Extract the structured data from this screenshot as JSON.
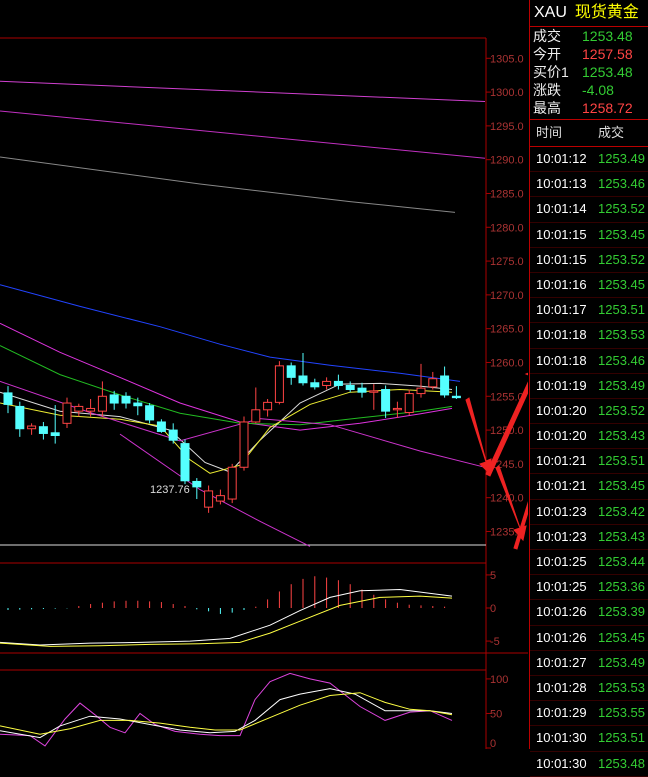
{
  "sidebar": {
    "symbol": "XAU",
    "name": "现货黄金",
    "quotes": [
      {
        "label": "成交",
        "value": "1253.48",
        "color": "#3c3"
      },
      {
        "label": "今开",
        "value": "1257.58",
        "color": "#f44"
      },
      {
        "label": "买价1",
        "value": "1253.48",
        "color": "#3c3"
      },
      {
        "label": "涨跌",
        "value": "-4.08",
        "color": "#3c3"
      },
      {
        "label": "最高",
        "value": "1258.72",
        "color": "#f44"
      }
    ],
    "tick_header": {
      "time": "时间",
      "price": "成交"
    },
    "ticks": [
      {
        "time": "10:01:12",
        "price": "1253.49"
      },
      {
        "time": "10:01:13",
        "price": "1253.46"
      },
      {
        "time": "10:01:14",
        "price": "1253.52"
      },
      {
        "time": "10:01:15",
        "price": "1253.45"
      },
      {
        "time": "10:01:15",
        "price": "1253.52"
      },
      {
        "time": "10:01:16",
        "price": "1253.45"
      },
      {
        "time": "10:01:17",
        "price": "1253.51"
      },
      {
        "time": "10:01:18",
        "price": "1253.53"
      },
      {
        "time": "10:01:18",
        "price": "1253.46"
      },
      {
        "time": "10:01:19",
        "price": "1253.49"
      },
      {
        "time": "10:01:20",
        "price": "1253.52"
      },
      {
        "time": "10:01:20",
        "price": "1253.43"
      },
      {
        "time": "10:01:21",
        "price": "1253.51"
      },
      {
        "time": "10:01:21",
        "price": "1253.45"
      },
      {
        "time": "10:01:23",
        "price": "1253.42"
      },
      {
        "time": "10:01:23",
        "price": "1253.43"
      },
      {
        "time": "10:01:25",
        "price": "1253.44"
      },
      {
        "time": "10:01:25",
        "price": "1253.36"
      },
      {
        "time": "10:01:26",
        "price": "1253.39"
      },
      {
        "time": "10:01:26",
        "price": "1253.45"
      },
      {
        "time": "10:01:27",
        "price": "1253.49"
      },
      {
        "time": "10:01:28",
        "price": "1253.53"
      },
      {
        "time": "10:01:29",
        "price": "1253.55"
      },
      {
        "time": "10:01:30",
        "price": "1253.51"
      },
      {
        "time": "10:01:30",
        "price": "1253.48"
      }
    ]
  },
  "chart_data": {
    "type": "candlestick",
    "price_ticks": [
      "1305.0",
      "1300.0",
      "1295.0",
      "1290.0",
      "1285.0",
      "1280.0",
      "1275.0",
      "1270.0",
      "1265.0",
      "1260.0",
      "1255.0",
      "1250.0",
      "1245.0",
      "1240.0",
      "1235.0"
    ],
    "ylim": [
      1233,
      1308
    ],
    "low_annotation": "1237.76",
    "candles": [
      {
        "o": 1255.5,
        "h": 1256.5,
        "l": 1252.5,
        "c": 1253.8
      },
      {
        "o": 1253.5,
        "h": 1254.2,
        "l": 1249.0,
        "c": 1250.2
      },
      {
        "o": 1250.2,
        "h": 1251.0,
        "l": 1249.3,
        "c": 1250.6
      },
      {
        "o": 1250.5,
        "h": 1251.2,
        "l": 1248.6,
        "c": 1249.5
      },
      {
        "o": 1249.6,
        "h": 1253.7,
        "l": 1248.0,
        "c": 1249.2
      },
      {
        "o": 1251.0,
        "h": 1254.8,
        "l": 1250.3,
        "c": 1254.0
      },
      {
        "o": 1252.8,
        "h": 1253.9,
        "l": 1252.0,
        "c": 1253.5
      },
      {
        "o": 1252.8,
        "h": 1254.6,
        "l": 1252.0,
        "c": 1253.2
      },
      {
        "o": 1252.8,
        "h": 1257.2,
        "l": 1252.0,
        "c": 1255.0
      },
      {
        "o": 1255.2,
        "h": 1255.8,
        "l": 1253.0,
        "c": 1254.0
      },
      {
        "o": 1255.0,
        "h": 1255.6,
        "l": 1253.2,
        "c": 1254.0
      },
      {
        "o": 1254.0,
        "h": 1254.8,
        "l": 1252.2,
        "c": 1253.6
      },
      {
        "o": 1253.6,
        "h": 1254.0,
        "l": 1251.0,
        "c": 1251.5
      },
      {
        "o": 1251.2,
        "h": 1251.6,
        "l": 1249.6,
        "c": 1249.8
      },
      {
        "o": 1250.0,
        "h": 1251.0,
        "l": 1248.0,
        "c": 1248.5
      },
      {
        "o": 1248.0,
        "h": 1248.6,
        "l": 1242.0,
        "c": 1242.5
      },
      {
        "o": 1242.4,
        "h": 1242.9,
        "l": 1239.8,
        "c": 1241.6
      },
      {
        "o": 1238.6,
        "h": 1241.8,
        "l": 1237.76,
        "c": 1241.0
      },
      {
        "o": 1239.5,
        "h": 1241.2,
        "l": 1239.0,
        "c": 1240.3
      },
      {
        "o": 1239.8,
        "h": 1245.0,
        "l": 1239.2,
        "c": 1244.5
      },
      {
        "o": 1244.5,
        "h": 1252.0,
        "l": 1244.0,
        "c": 1251.2
      },
      {
        "o": 1251.2,
        "h": 1256.3,
        "l": 1251.0,
        "c": 1253.0
      },
      {
        "o": 1253.0,
        "h": 1254.6,
        "l": 1252.0,
        "c": 1254.1
      },
      {
        "o": 1254.1,
        "h": 1260.2,
        "l": 1253.8,
        "c": 1259.5
      },
      {
        "o": 1259.5,
        "h": 1260.0,
        "l": 1256.7,
        "c": 1257.8
      },
      {
        "o": 1258.0,
        "h": 1261.4,
        "l": 1256.6,
        "c": 1257.0
      },
      {
        "o": 1257.0,
        "h": 1257.6,
        "l": 1256.0,
        "c": 1256.4
      },
      {
        "o": 1256.6,
        "h": 1257.8,
        "l": 1256.0,
        "c": 1257.2
      },
      {
        "o": 1257.2,
        "h": 1258.2,
        "l": 1256.0,
        "c": 1256.6
      },
      {
        "o": 1256.6,
        "h": 1257.2,
        "l": 1255.6,
        "c": 1256.0
      },
      {
        "o": 1256.2,
        "h": 1257.0,
        "l": 1254.8,
        "c": 1255.6
      },
      {
        "o": 1255.6,
        "h": 1256.8,
        "l": 1253.0,
        "c": 1255.8
      },
      {
        "o": 1256.0,
        "h": 1256.6,
        "l": 1251.8,
        "c": 1252.8
      },
      {
        "o": 1253.0,
        "h": 1254.2,
        "l": 1251.8,
        "c": 1253.2
      },
      {
        "o": 1252.6,
        "h": 1256.0,
        "l": 1252.2,
        "c": 1255.4
      },
      {
        "o": 1255.4,
        "h": 1259.8,
        "l": 1254.8,
        "c": 1256.2
      },
      {
        "o": 1256.4,
        "h": 1258.6,
        "l": 1256.0,
        "c": 1257.6
      },
      {
        "o": 1258.0,
        "h": 1259.4,
        "l": 1254.8,
        "c": 1255.2
      },
      {
        "o": 1255.0,
        "h": 1256.5,
        "l": 1254.6,
        "c": 1254.8
      }
    ],
    "ma_lines": [
      {
        "color": "#d040d0",
        "points": [
          [
            0,
            1301.6
          ],
          [
            485,
            1298.6
          ]
        ]
      },
      {
        "color": "#c030c0",
        "points": [
          [
            0,
            1297.2
          ],
          [
            485,
            1290.2
          ]
        ]
      },
      {
        "color": "#888888",
        "points": [
          [
            0,
            1290.4
          ],
          [
            200,
            1286.4
          ],
          [
            350,
            1283.8
          ],
          [
            455,
            1282.2
          ]
        ]
      },
      {
        "color": "#2244ff",
        "points": [
          [
            0,
            1271.5
          ],
          [
            80,
            1268.3
          ],
          [
            160,
            1265.3
          ],
          [
            220,
            1262.7
          ],
          [
            270,
            1260.8
          ],
          [
            330,
            1259.6
          ],
          [
            400,
            1258.4
          ],
          [
            460,
            1257.2
          ]
        ]
      },
      {
        "color": "#dd33dd",
        "points": [
          [
            0,
            1265.8
          ],
          [
            60,
            1261.5
          ],
          [
            120,
            1257.8
          ],
          [
            180,
            1254.0
          ],
          [
            240,
            1251.2
          ],
          [
            300,
            1250.0
          ],
          [
            360,
            1251.0
          ],
          [
            420,
            1252.4
          ],
          [
            452,
            1253.2
          ]
        ]
      },
      {
        "color": "#22bb22",
        "points": [
          [
            0,
            1262.5
          ],
          [
            60,
            1258.2
          ],
          [
            120,
            1255.2
          ],
          [
            180,
            1252.5
          ],
          [
            240,
            1251.0
          ],
          [
            300,
            1250.8
          ],
          [
            360,
            1251.8
          ],
          [
            420,
            1252.8
          ],
          [
            452,
            1253.5
          ]
        ]
      },
      {
        "color": "#dddddd",
        "points": [
          [
            0,
            1255.6
          ],
          [
            60,
            1252.8
          ],
          [
            120,
            1252.0
          ],
          [
            170,
            1250.0
          ],
          [
            205,
            1245.2
          ],
          [
            230,
            1243.8
          ],
          [
            260,
            1248.5
          ],
          [
            300,
            1254.0
          ],
          [
            340,
            1256.8
          ],
          [
            380,
            1256.9
          ],
          [
            420,
            1256.5
          ],
          [
            452,
            1256.0
          ]
        ]
      },
      {
        "color": "#eeee33",
        "points": [
          [
            0,
            1254.0
          ],
          [
            60,
            1252.2
          ],
          [
            120,
            1251.6
          ],
          [
            160,
            1250.6
          ],
          [
            190,
            1245.6
          ],
          [
            210,
            1243.6
          ],
          [
            240,
            1244.8
          ],
          [
            270,
            1250.4
          ],
          [
            310,
            1253.8
          ],
          [
            350,
            1255.6
          ],
          [
            400,
            1256.0
          ],
          [
            452,
            1255.6
          ]
        ]
      },
      {
        "color": "#cc33cc",
        "points": [
          [
            0,
            1257.2
          ],
          [
            90,
            1252.6
          ],
          [
            180,
            1248.4
          ],
          [
            260,
            1251.7
          ],
          [
            330,
            1250.8
          ],
          [
            420,
            1246.9
          ],
          [
            485,
            1244.5
          ]
        ]
      },
      {
        "color": "#cc33cc",
        "points": [
          [
            120,
            1249.4
          ],
          [
            200,
            1241.2
          ],
          [
            260,
            1236.5
          ],
          [
            310,
            1232.8
          ]
        ]
      }
    ],
    "macd": {
      "ticks": [
        "5",
        "0",
        "-5"
      ],
      "ylim": [
        -6.5,
        6.5
      ],
      "hist": [
        -0.3,
        -0.25,
        -0.2,
        -0.15,
        -0.1,
        -0.05,
        0.3,
        0.6,
        0.8,
        1.0,
        1.1,
        1.1,
        1.0,
        0.9,
        0.6,
        0.3,
        -0.2,
        -0.5,
        -0.9,
        -0.7,
        -0.3,
        0.2,
        1.3,
        2.5,
        3.6,
        4.4,
        4.8,
        4.6,
        4.2,
        3.6,
        2.8,
        2.0,
        1.3,
        0.8,
        0.5,
        0.4,
        0.3,
        0.2
      ],
      "lines": [
        {
          "color": "#ffffff",
          "points": [
            [
              0,
              -5.2
            ],
            [
              40,
              -5.6
            ],
            [
              90,
              -5.3
            ],
            [
              140,
              -5.2
            ],
            [
              190,
              -5.0
            ],
            [
              230,
              -4.6
            ],
            [
              270,
              -2.6
            ],
            [
              300,
              -0.4
            ],
            [
              330,
              1.6
            ],
            [
              360,
              2.6
            ],
            [
              400,
              2.8
            ],
            [
              452,
              1.8
            ]
          ]
        },
        {
          "color": "#ffff44",
          "points": [
            [
              0,
              -5.3
            ],
            [
              50,
              -5.8
            ],
            [
              100,
              -5.7
            ],
            [
              150,
              -5.5
            ],
            [
              200,
              -5.4
            ],
            [
              240,
              -5.2
            ],
            [
              270,
              -3.8
            ],
            [
              300,
              -2.0
            ],
            [
              340,
              0.4
            ],
            [
              380,
              1.6
            ],
            [
              420,
              1.8
            ],
            [
              452,
              1.5
            ]
          ]
        }
      ]
    },
    "kdj": {
      "ticks": [
        "100",
        "50",
        "0"
      ],
      "ylim": [
        0,
        110
      ],
      "lines": [
        {
          "color": "#dd44dd",
          "points": [
            [
              0,
              20
            ],
            [
              30,
              18
            ],
            [
              45,
              3
            ],
            [
              65,
              42
            ],
            [
              80,
              65
            ],
            [
              95,
              48
            ],
            [
              110,
              30
            ],
            [
              125,
              22
            ],
            [
              140,
              50
            ],
            [
              155,
              34
            ],
            [
              175,
              24
            ],
            [
              200,
              20
            ],
            [
              220,
              18
            ],
            [
              240,
              18
            ],
            [
              255,
              70
            ],
            [
              270,
              96
            ],
            [
              290,
              108
            ],
            [
              310,
              100
            ],
            [
              330,
              94
            ],
            [
              360,
              60
            ],
            [
              385,
              40
            ],
            [
              410,
              52
            ],
            [
              430,
              54
            ],
            [
              452,
              40
            ]
          ]
        },
        {
          "color": "#ffffff",
          "points": [
            [
              0,
              25
            ],
            [
              40,
              15
            ],
            [
              60,
              32
            ],
            [
              90,
              46
            ],
            [
              120,
              42
            ],
            [
              150,
              34
            ],
            [
              180,
              26
            ],
            [
              210,
              22
            ],
            [
              235,
              24
            ],
            [
              255,
              40
            ],
            [
              280,
              70
            ],
            [
              300,
              78
            ],
            [
              330,
              86
            ],
            [
              355,
              78
            ],
            [
              385,
              54
            ],
            [
              410,
              54
            ],
            [
              430,
              54
            ],
            [
              452,
              50
            ]
          ]
        },
        {
          "color": "#ffff44",
          "points": [
            [
              0,
              32
            ],
            [
              40,
              20
            ],
            [
              70,
              28
            ],
            [
              100,
              40
            ],
            [
              130,
              40
            ],
            [
              160,
              36
            ],
            [
              190,
              30
            ],
            [
              215,
              26
            ],
            [
              240,
              26
            ],
            [
              270,
              44
            ],
            [
              300,
              62
            ],
            [
              330,
              76
            ],
            [
              360,
              80
            ],
            [
              385,
              66
            ],
            [
              410,
              56
            ],
            [
              430,
              54
            ],
            [
              452,
              48
            ]
          ]
        }
      ]
    }
  }
}
